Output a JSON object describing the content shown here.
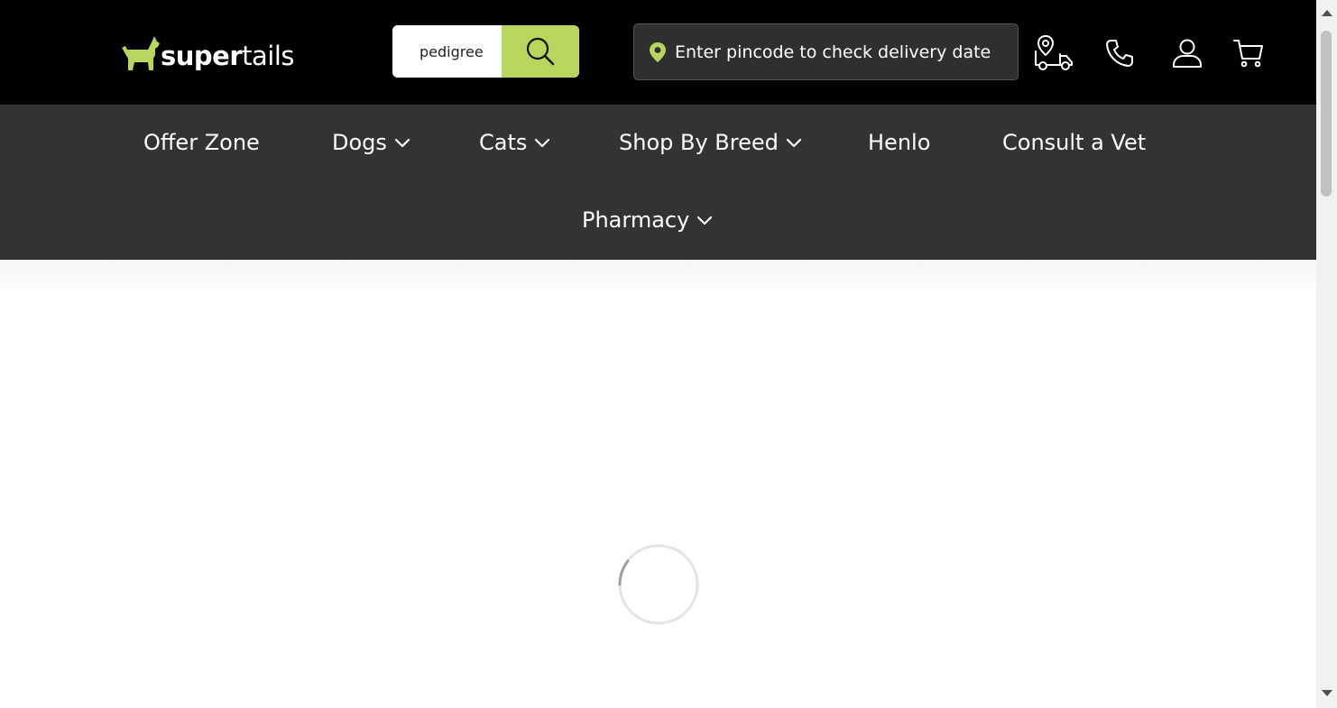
{
  "brand": {
    "name_bold": "super",
    "name_light": "tails",
    "accent": "#b7d65c"
  },
  "search": {
    "value": "pedigree",
    "button_icon": "search-icon"
  },
  "pincode": {
    "icon": "location-pin-icon",
    "text": "Enter pincode to check delivery date"
  },
  "header_icons": [
    "delivery-truck-icon",
    "phone-icon",
    "user-icon",
    "cart-icon"
  ],
  "nav": {
    "items": [
      {
        "label": "Offer Zone",
        "dropdown": false
      },
      {
        "label": "Dogs",
        "dropdown": true
      },
      {
        "label": "Cats",
        "dropdown": true
      },
      {
        "label": "Shop By Breed",
        "dropdown": true
      },
      {
        "label": "Henlo",
        "dropdown": false
      },
      {
        "label": "Consult a Vet",
        "dropdown": false
      },
      {
        "label": "Pharmacy",
        "dropdown": true
      }
    ]
  },
  "colors": {
    "header_bg": "#000000",
    "nav_bg": "#333333",
    "pincode_bg": "#2f2f2f"
  },
  "content": {
    "state": "loading",
    "icon": "loading-spinner-icon"
  }
}
